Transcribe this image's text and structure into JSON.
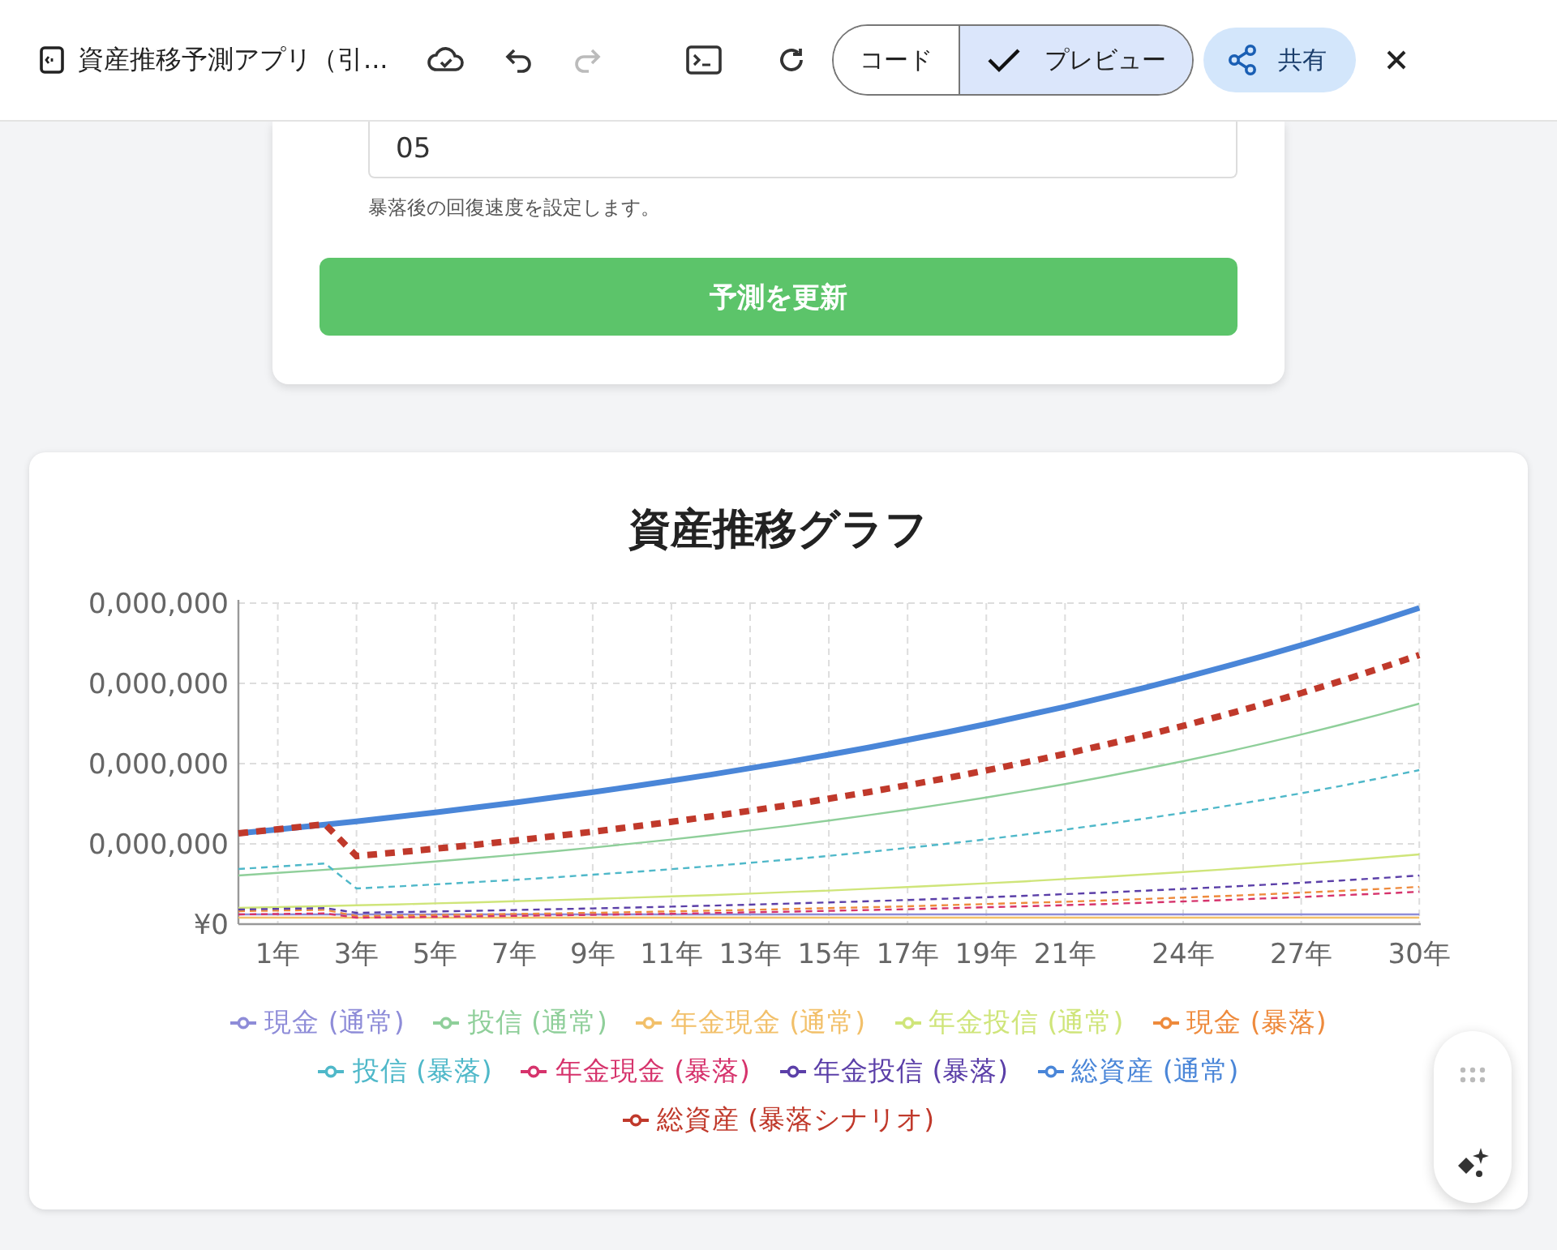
{
  "toolbar": {
    "title": "資産推移予測アプリ（引...",
    "undo": {
      "disabled": false
    },
    "redo": {
      "disabled": true
    },
    "view_toggle": [
      {
        "label": "コード",
        "selected": false
      },
      {
        "label": "プレビュー",
        "selected": true
      }
    ],
    "share_button": "共有"
  },
  "settings_card": {
    "input_value": "05",
    "help_text": "暴落後の回復速度を設定します。",
    "submit_button": "予測を更新"
  },
  "chart_card": {
    "title": "資産推移グラフ",
    "y_axis_labels": [
      "0,000,000",
      "0,000,000",
      "0,000,000",
      "0,000,000",
      "¥0"
    ],
    "x_axis_labels": [
      "1年",
      "3年",
      "5年",
      "7年",
      "9年",
      "11年",
      "13年",
      "15年",
      "17年",
      "19年",
      "21年",
      "24年",
      "27年",
      "30年"
    ],
    "legend": [
      {
        "label": "現金 (通常)",
        "color": "#8e8cd8"
      },
      {
        "label": "投信 (通常)",
        "color": "#8fcf9a"
      },
      {
        "label": "年金現金 (通常)",
        "color": "#f2c06a"
      },
      {
        "label": "年金投信 (通常)",
        "color": "#cfe57a"
      },
      {
        "label": "現金 (暴落)",
        "color": "#ee8a3c"
      },
      {
        "label": "投信 (暴落)",
        "color": "#4fb8c9"
      },
      {
        "label": "年金現金 (暴落)",
        "color": "#d6336c"
      },
      {
        "label": "年金投信 (暴落)",
        "color": "#5b3fa8"
      },
      {
        "label": "総資産 (通常)",
        "color": "#4a86d8"
      },
      {
        "label": "総資産 (暴落シナリオ)",
        "color": "#c0392b"
      }
    ]
  }
}
